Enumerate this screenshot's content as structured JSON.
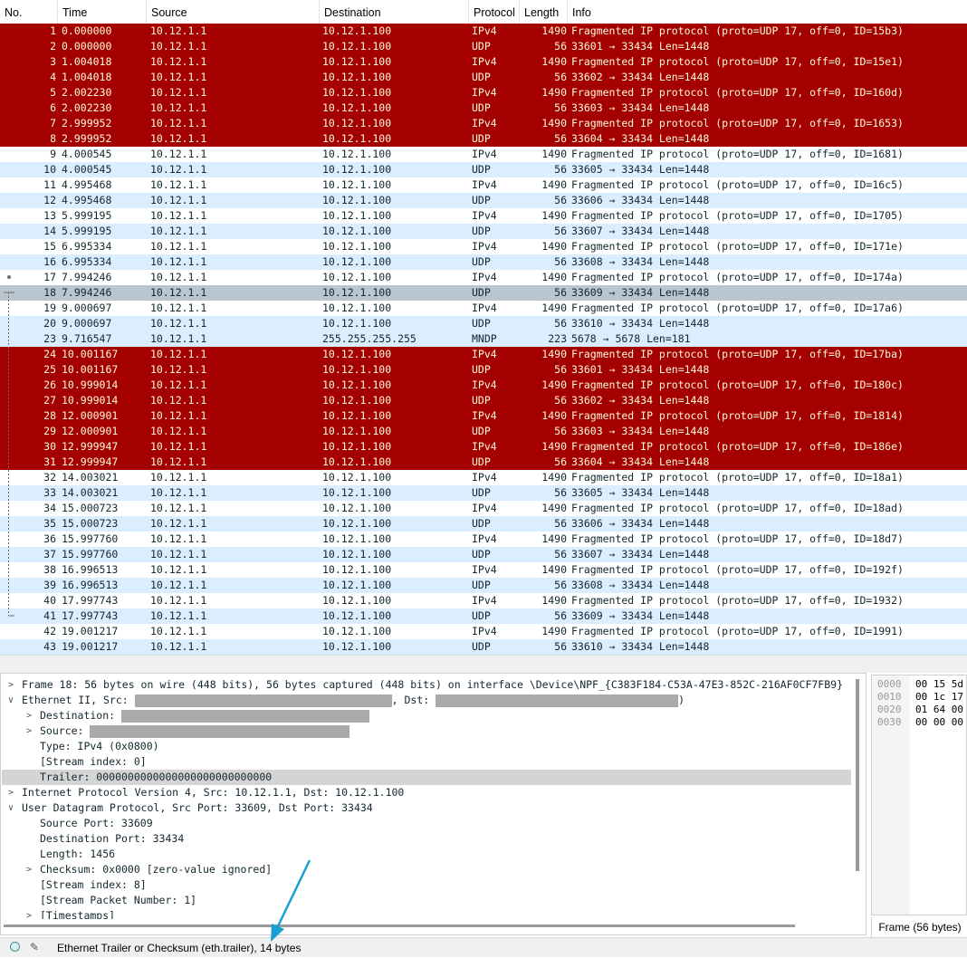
{
  "columns": {
    "no": "No.",
    "time": "Time",
    "source": "Source",
    "destination": "Destination",
    "protocol": "Protocol",
    "length": "Length",
    "info": "Info"
  },
  "colors": {
    "bad_bg": "#a40000",
    "bad_fg": "#fffbd8",
    "alt_bg": "#daeeff",
    "selected_bg": "#b9c6d0",
    "arrow": "#1a9fd0"
  },
  "packets": [
    {
      "no": "1",
      "time": "0.000000",
      "src": "10.12.1.1",
      "dst": "10.12.1.100",
      "proto": "IPv4",
      "len": "1490",
      "info": "Fragmented IP protocol (proto=UDP 17, off=0, ID=15b3)",
      "style": "bad"
    },
    {
      "no": "2",
      "time": "0.000000",
      "src": "10.12.1.1",
      "dst": "10.12.1.100",
      "proto": "UDP",
      "len": "56",
      "info": "33601 → 33434 Len=1448",
      "style": "bad"
    },
    {
      "no": "3",
      "time": "1.004018",
      "src": "10.12.1.1",
      "dst": "10.12.1.100",
      "proto": "IPv4",
      "len": "1490",
      "info": "Fragmented IP protocol (proto=UDP 17, off=0, ID=15e1)",
      "style": "bad"
    },
    {
      "no": "4",
      "time": "1.004018",
      "src": "10.12.1.1",
      "dst": "10.12.1.100",
      "proto": "UDP",
      "len": "56",
      "info": "33602 → 33434 Len=1448",
      "style": "bad"
    },
    {
      "no": "5",
      "time": "2.002230",
      "src": "10.12.1.1",
      "dst": "10.12.1.100",
      "proto": "IPv4",
      "len": "1490",
      "info": "Fragmented IP protocol (proto=UDP 17, off=0, ID=160d)",
      "style": "bad"
    },
    {
      "no": "6",
      "time": "2.002230",
      "src": "10.12.1.1",
      "dst": "10.12.1.100",
      "proto": "UDP",
      "len": "56",
      "info": "33603 → 33434 Len=1448",
      "style": "bad"
    },
    {
      "no": "7",
      "time": "2.999952",
      "src": "10.12.1.1",
      "dst": "10.12.1.100",
      "proto": "IPv4",
      "len": "1490",
      "info": "Fragmented IP protocol (proto=UDP 17, off=0, ID=1653)",
      "style": "bad"
    },
    {
      "no": "8",
      "time": "2.999952",
      "src": "10.12.1.1",
      "dst": "10.12.1.100",
      "proto": "UDP",
      "len": "56",
      "info": "33604 → 33434 Len=1448",
      "style": "bad"
    },
    {
      "no": "9",
      "time": "4.000545",
      "src": "10.12.1.1",
      "dst": "10.12.1.100",
      "proto": "IPv4",
      "len": "1490",
      "info": "Fragmented IP protocol (proto=UDP 17, off=0, ID=1681)",
      "style": "white"
    },
    {
      "no": "10",
      "time": "4.000545",
      "src": "10.12.1.1",
      "dst": "10.12.1.100",
      "proto": "UDP",
      "len": "56",
      "info": "33605 → 33434 Len=1448",
      "style": "blue"
    },
    {
      "no": "11",
      "time": "4.995468",
      "src": "10.12.1.1",
      "dst": "10.12.1.100",
      "proto": "IPv4",
      "len": "1490",
      "info": "Fragmented IP protocol (proto=UDP 17, off=0, ID=16c5)",
      "style": "white"
    },
    {
      "no": "12",
      "time": "4.995468",
      "src": "10.12.1.1",
      "dst": "10.12.1.100",
      "proto": "UDP",
      "len": "56",
      "info": "33606 → 33434 Len=1448",
      "style": "blue"
    },
    {
      "no": "13",
      "time": "5.999195",
      "src": "10.12.1.1",
      "dst": "10.12.1.100",
      "proto": "IPv4",
      "len": "1490",
      "info": "Fragmented IP protocol (proto=UDP 17, off=0, ID=1705)",
      "style": "white"
    },
    {
      "no": "14",
      "time": "5.999195",
      "src": "10.12.1.1",
      "dst": "10.12.1.100",
      "proto": "UDP",
      "len": "56",
      "info": "33607 → 33434 Len=1448",
      "style": "blue"
    },
    {
      "no": "15",
      "time": "6.995334",
      "src": "10.12.1.1",
      "dst": "10.12.1.100",
      "proto": "IPv4",
      "len": "1490",
      "info": "Fragmented IP protocol (proto=UDP 17, off=0, ID=171e)",
      "style": "white"
    },
    {
      "no": "16",
      "time": "6.995334",
      "src": "10.12.1.1",
      "dst": "10.12.1.100",
      "proto": "UDP",
      "len": "56",
      "info": "33608 → 33434 Len=1448",
      "style": "blue"
    },
    {
      "no": "17",
      "time": "7.994246",
      "src": "10.12.1.1",
      "dst": "10.12.1.100",
      "proto": "IPv4",
      "len": "1490",
      "info": "Fragmented IP protocol (proto=UDP 17, off=0, ID=174a)",
      "style": "white"
    },
    {
      "no": "18",
      "time": "7.994246",
      "src": "10.12.1.1",
      "dst": "10.12.1.100",
      "proto": "UDP",
      "len": "56",
      "info": "33609 → 33434 Len=1448",
      "style": "sel"
    },
    {
      "no": "19",
      "time": "9.000697",
      "src": "10.12.1.1",
      "dst": "10.12.1.100",
      "proto": "IPv4",
      "len": "1490",
      "info": "Fragmented IP protocol (proto=UDP 17, off=0, ID=17a6)",
      "style": "white"
    },
    {
      "no": "20",
      "time": "9.000697",
      "src": "10.12.1.1",
      "dst": "10.12.1.100",
      "proto": "UDP",
      "len": "56",
      "info": "33610 → 33434 Len=1448",
      "style": "blue"
    },
    {
      "no": "23",
      "time": "9.716547",
      "src": "10.12.1.1",
      "dst": "255.255.255.255",
      "proto": "MNDP",
      "len": "223",
      "info": "5678 → 5678 Len=181",
      "style": "blue"
    },
    {
      "no": "24",
      "time": "10.001167",
      "src": "10.12.1.1",
      "dst": "10.12.1.100",
      "proto": "IPv4",
      "len": "1490",
      "info": "Fragmented IP protocol (proto=UDP 17, off=0, ID=17ba)",
      "style": "bad"
    },
    {
      "no": "25",
      "time": "10.001167",
      "src": "10.12.1.1",
      "dst": "10.12.1.100",
      "proto": "UDP",
      "len": "56",
      "info": "33601 → 33434 Len=1448",
      "style": "bad"
    },
    {
      "no": "26",
      "time": "10.999014",
      "src": "10.12.1.1",
      "dst": "10.12.1.100",
      "proto": "IPv4",
      "len": "1490",
      "info": "Fragmented IP protocol (proto=UDP 17, off=0, ID=180c)",
      "style": "bad"
    },
    {
      "no": "27",
      "time": "10.999014",
      "src": "10.12.1.1",
      "dst": "10.12.1.100",
      "proto": "UDP",
      "len": "56",
      "info": "33602 → 33434 Len=1448",
      "style": "bad"
    },
    {
      "no": "28",
      "time": "12.000901",
      "src": "10.12.1.1",
      "dst": "10.12.1.100",
      "proto": "IPv4",
      "len": "1490",
      "info": "Fragmented IP protocol (proto=UDP 17, off=0, ID=1814)",
      "style": "bad"
    },
    {
      "no": "29",
      "time": "12.000901",
      "src": "10.12.1.1",
      "dst": "10.12.1.100",
      "proto": "UDP",
      "len": "56",
      "info": "33603 → 33434 Len=1448",
      "style": "bad"
    },
    {
      "no": "30",
      "time": "12.999947",
      "src": "10.12.1.1",
      "dst": "10.12.1.100",
      "proto": "IPv4",
      "len": "1490",
      "info": "Fragmented IP protocol (proto=UDP 17, off=0, ID=186e)",
      "style": "bad"
    },
    {
      "no": "31",
      "time": "12.999947",
      "src": "10.12.1.1",
      "dst": "10.12.1.100",
      "proto": "UDP",
      "len": "56",
      "info": "33604 → 33434 Len=1448",
      "style": "bad"
    },
    {
      "no": "32",
      "time": "14.003021",
      "src": "10.12.1.1",
      "dst": "10.12.1.100",
      "proto": "IPv4",
      "len": "1490",
      "info": "Fragmented IP protocol (proto=UDP 17, off=0, ID=18a1)",
      "style": "white"
    },
    {
      "no": "33",
      "time": "14.003021",
      "src": "10.12.1.1",
      "dst": "10.12.1.100",
      "proto": "UDP",
      "len": "56",
      "info": "33605 → 33434 Len=1448",
      "style": "blue"
    },
    {
      "no": "34",
      "time": "15.000723",
      "src": "10.12.1.1",
      "dst": "10.12.1.100",
      "proto": "IPv4",
      "len": "1490",
      "info": "Fragmented IP protocol (proto=UDP 17, off=0, ID=18ad)",
      "style": "white"
    },
    {
      "no": "35",
      "time": "15.000723",
      "src": "10.12.1.1",
      "dst": "10.12.1.100",
      "proto": "UDP",
      "len": "56",
      "info": "33606 → 33434 Len=1448",
      "style": "blue"
    },
    {
      "no": "36",
      "time": "15.997760",
      "src": "10.12.1.1",
      "dst": "10.12.1.100",
      "proto": "IPv4",
      "len": "1490",
      "info": "Fragmented IP protocol (proto=UDP 17, off=0, ID=18d7)",
      "style": "white"
    },
    {
      "no": "37",
      "time": "15.997760",
      "src": "10.12.1.1",
      "dst": "10.12.1.100",
      "proto": "UDP",
      "len": "56",
      "info": "33607 → 33434 Len=1448",
      "style": "blue"
    },
    {
      "no": "38",
      "time": "16.996513",
      "src": "10.12.1.1",
      "dst": "10.12.1.100",
      "proto": "IPv4",
      "len": "1490",
      "info": "Fragmented IP protocol (proto=UDP 17, off=0, ID=192f)",
      "style": "white"
    },
    {
      "no": "39",
      "time": "16.996513",
      "src": "10.12.1.1",
      "dst": "10.12.1.100",
      "proto": "UDP",
      "len": "56",
      "info": "33608 → 33434 Len=1448",
      "style": "blue"
    },
    {
      "no": "40",
      "time": "17.997743",
      "src": "10.12.1.1",
      "dst": "10.12.1.100",
      "proto": "IPv4",
      "len": "1490",
      "info": "Fragmented IP protocol (proto=UDP 17, off=0, ID=1932)",
      "style": "white"
    },
    {
      "no": "41",
      "time": "17.997743",
      "src": "10.12.1.1",
      "dst": "10.12.1.100",
      "proto": "UDP",
      "len": "56",
      "info": "33609 → 33434 Len=1448",
      "style": "blue"
    },
    {
      "no": "42",
      "time": "19.001217",
      "src": "10.12.1.1",
      "dst": "10.12.1.100",
      "proto": "IPv4",
      "len": "1490",
      "info": "Fragmented IP protocol (proto=UDP 17, off=0, ID=1991)",
      "style": "white"
    },
    {
      "no": "43",
      "time": "19.001217",
      "src": "10.12.1.1",
      "dst": "10.12.1.100",
      "proto": "UDP",
      "len": "56",
      "info": "33610 → 33434 Len=1448",
      "style": "blue"
    }
  ],
  "details": {
    "frame": "Frame 18: 56 bytes on wire (448 bits), 56 bytes captured (448 bits) on interface \\Device\\NPF_{C383F184-C53A-47E3-852C-216AF0CF7FB9}",
    "eth_prefix": "Ethernet II, Src: ",
    "eth_mid": ", Dst: ",
    "eth_suffix": ")",
    "eth_destination": "Destination: ",
    "eth_source": "Source: ",
    "eth_type": "Type: IPv4 (0x0800)",
    "eth_stream": "[Stream index: 0]",
    "eth_trailer": "Trailer: 0000000000000000000000000000",
    "ip": "Internet Protocol Version 4, Src: 10.12.1.1, Dst: 10.12.1.100",
    "udp": "User Datagram Protocol, Src Port: 33609, Dst Port: 33434",
    "udp_srcport": "Source Port: 33609",
    "udp_dstport": "Destination Port: 33434",
    "udp_length": "Length: 1456",
    "udp_checksum": "Checksum: 0x0000 [zero-value ignored]",
    "udp_stream": "[Stream index: 8]",
    "udp_packet_number": "[Stream Packet Number: 1]",
    "udp_timestamps": "[Timestamps]"
  },
  "bytes": {
    "rows": [
      {
        "offset": "0000",
        "hex": "00 15 5d"
      },
      {
        "offset": "0010",
        "hex": "00 1c 17"
      },
      {
        "offset": "0020",
        "hex": "01 64 00"
      },
      {
        "offset": "0030",
        "hex": "00 00 00"
      }
    ],
    "tab_label": "Frame (56 bytes)"
  },
  "status": {
    "field_text": "Ethernet Trailer or Checksum (eth.trailer), 14 bytes",
    "ready_icon": "circle-icon",
    "edit_icon": "pencil-note-icon"
  }
}
